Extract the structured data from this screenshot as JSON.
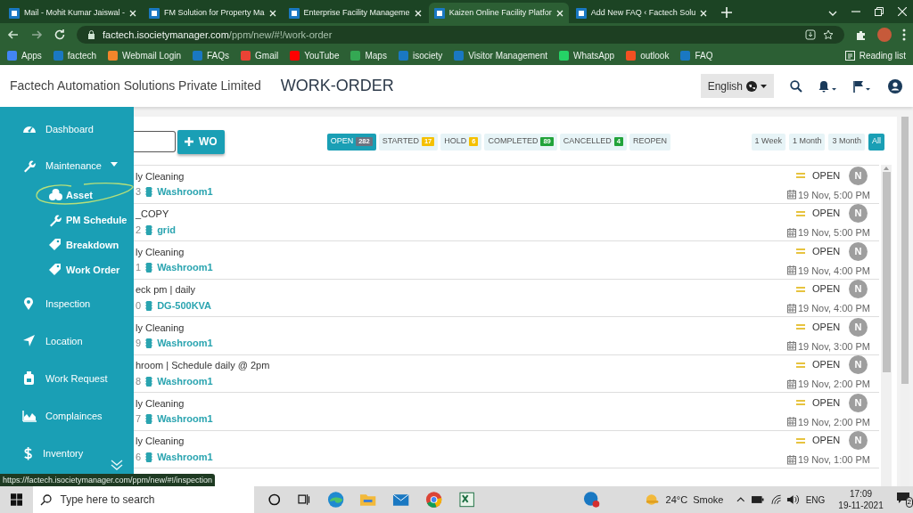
{
  "browser": {
    "tabs": [
      {
        "title": "Mail - Mohit Kumar Jaiswal -",
        "selected": false
      },
      {
        "title": "FM Solution for Property Ma",
        "selected": false
      },
      {
        "title": "Enterprise Facility Manageme",
        "selected": false
      },
      {
        "title": "Kaizen Online Facility Platfor",
        "selected": true
      },
      {
        "title": "Add New FAQ ‹ Factech Solu",
        "selected": false
      }
    ],
    "url_host": "factech.isocietymanager.com",
    "url_path": "/ppm/new/#!/work-order",
    "bookmarks": [
      "Apps",
      "factech",
      "Webmail Login",
      "FAQs",
      "Gmail",
      "YouTube",
      "Maps",
      "isociety",
      "Visitor Management",
      "WhatsApp",
      "outlook",
      "FAQ"
    ],
    "reading_list": "Reading list",
    "status_url": "https://factech.isocietymanager.com/ppm/new/#!/inspection"
  },
  "header": {
    "company": "Factech Automation Solutions Private Limited",
    "title": "WORK-ORDER",
    "language": "English"
  },
  "sidebar": {
    "items": [
      {
        "label": "Dashboard"
      },
      {
        "label": "Maintenance",
        "expanded": true,
        "children": [
          {
            "label": "Asset",
            "circled": true
          },
          {
            "label": "PM Schedule",
            "circled": false
          },
          {
            "label": "Breakdown",
            "circled": false
          },
          {
            "label": "Work Order",
            "circled": false
          }
        ]
      },
      {
        "label": "Inspection"
      },
      {
        "label": "Location"
      },
      {
        "label": "Work Request"
      },
      {
        "label": "Complainces"
      },
      {
        "label": "Inventory"
      }
    ]
  },
  "toolbar": {
    "add_button": "WO",
    "filters": [
      {
        "label": "OPEN",
        "count": "282",
        "selected": true,
        "color": "#6b7280"
      },
      {
        "label": "STARTED",
        "count": "17",
        "selected": false,
        "color": "#f5c000"
      },
      {
        "label": "HOLD",
        "count": "6",
        "selected": false,
        "color": "#f5c000"
      },
      {
        "label": "COMPLETED",
        "count": "89",
        "selected": false,
        "color": "#22a33a"
      },
      {
        "label": "CANCELLED",
        "count": "4",
        "selected": false,
        "color": "#22a33a"
      },
      {
        "label": "REOPEN",
        "selected": false
      }
    ],
    "ranges": [
      {
        "label": "1 Week",
        "selected": false
      },
      {
        "label": "1 Month",
        "selected": false
      },
      {
        "label": "3 Month",
        "selected": false
      },
      {
        "label": "All",
        "selected": true
      }
    ]
  },
  "work_orders": [
    {
      "title": "ly Cleaning",
      "number": "3",
      "asset": "Washroom1",
      "status": "OPEN",
      "assignee": "N",
      "due": "19 Nov, 5:00 PM"
    },
    {
      "title": "_COPY",
      "number": "2",
      "asset": "grid",
      "status": "OPEN",
      "assignee": "N",
      "due": "19 Nov, 5:00 PM"
    },
    {
      "title": "ly Cleaning",
      "number": "1",
      "asset": "Washroom1",
      "status": "OPEN",
      "assignee": "N",
      "due": "19 Nov, 4:00 PM"
    },
    {
      "title": "eck pm | daily",
      "number": "0",
      "asset": "DG-500KVA",
      "status": "OPEN",
      "assignee": "N",
      "due": "19 Nov, 4:00 PM"
    },
    {
      "title": "ly Cleaning",
      "number": "9",
      "asset": "Washroom1",
      "status": "OPEN",
      "assignee": "N",
      "due": "19 Nov, 3:00 PM"
    },
    {
      "title": "hroom | Schedule daily @ 2pm",
      "number": "8",
      "asset": "Washroom1",
      "status": "OPEN",
      "assignee": "N",
      "due": "19 Nov, 2:00 PM"
    },
    {
      "title": "ly Cleaning",
      "number": "7",
      "asset": "Washroom1",
      "status": "OPEN",
      "assignee": "N",
      "due": "19 Nov, 2:00 PM"
    },
    {
      "title": "ly Cleaning",
      "number": "6",
      "asset": "Washroom1",
      "status": "OPEN",
      "assignee": "N",
      "due": "19 Nov, 1:00 PM"
    }
  ],
  "taskbar": {
    "search_placeholder": "Type here to search",
    "weather": "24°C  Smoke",
    "language": "ENG",
    "time": "17:09",
    "date": "19-11-2021",
    "notifications": "2"
  }
}
